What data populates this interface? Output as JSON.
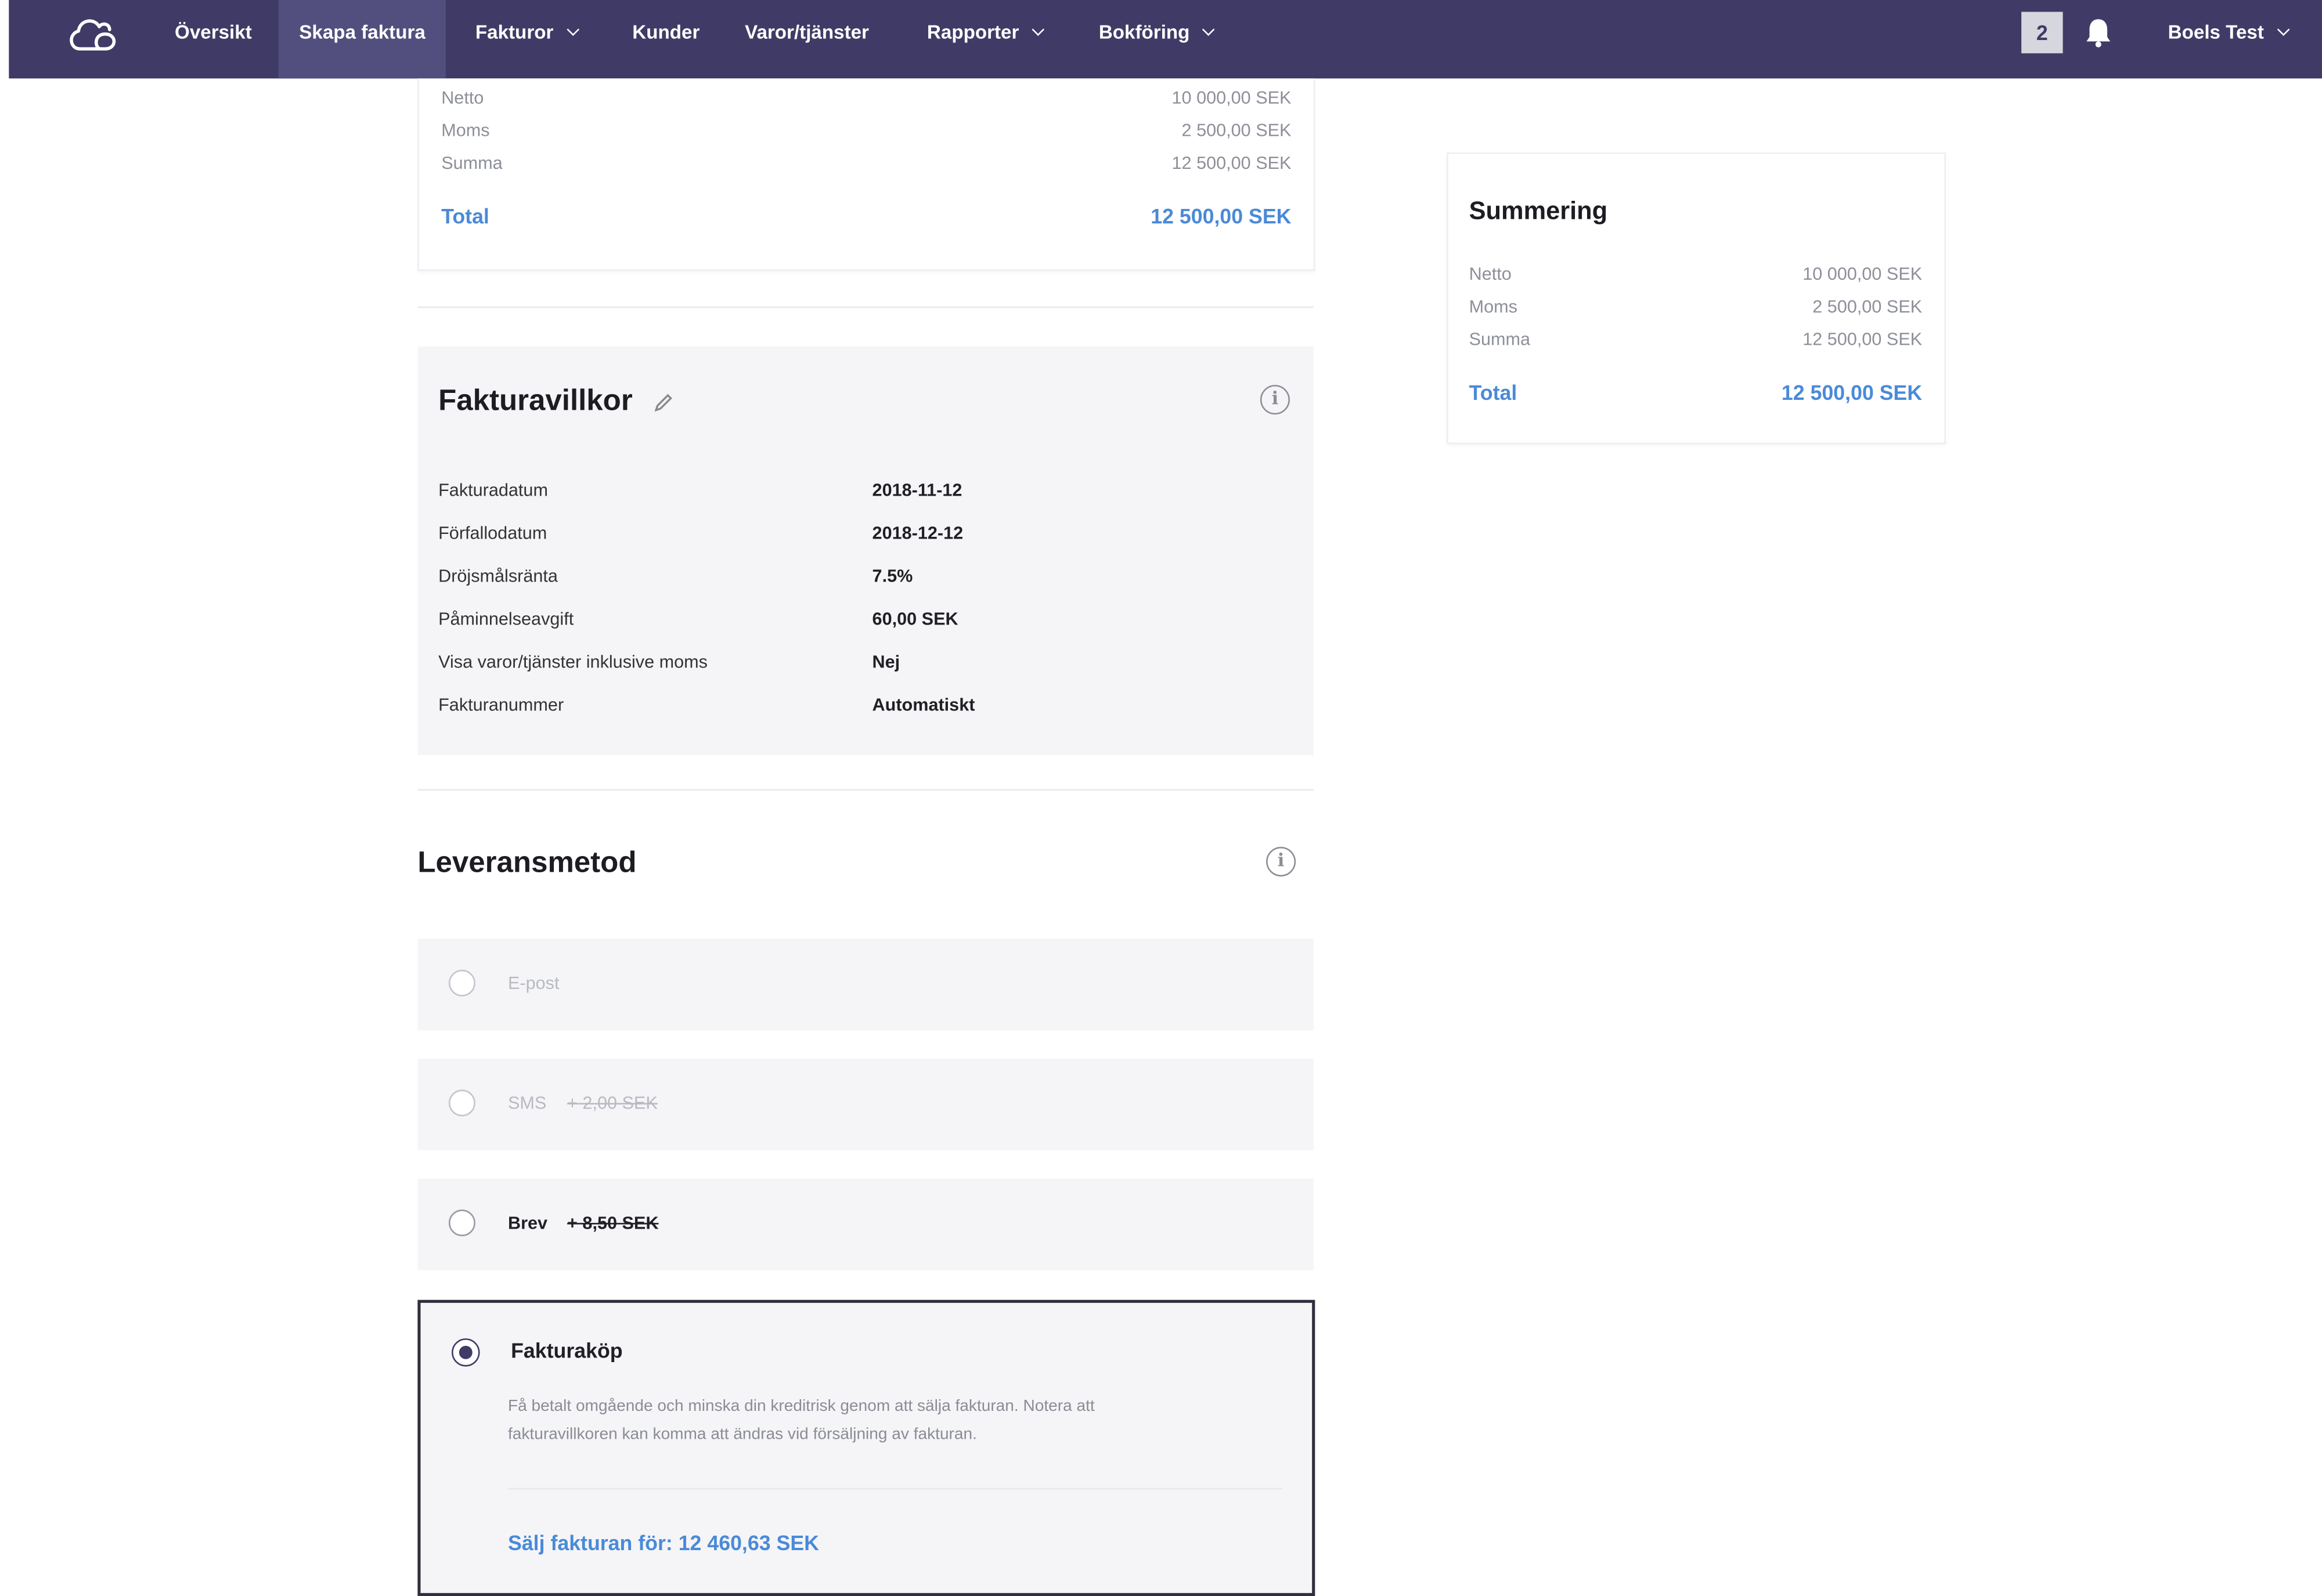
{
  "nav": {
    "items": [
      "Översikt",
      "Skapa faktura",
      "Fakturor",
      "Kunder",
      "Varor/tjänster",
      "Rapporter",
      "Bokföring"
    ],
    "notification_count": "2",
    "user": "Boels Test"
  },
  "top_summary": {
    "netto_label": "Netto",
    "netto_value": "10 000,00 SEK",
    "moms_label": "Moms",
    "moms_value": "2 500,00 SEK",
    "summa_label": "Summa",
    "summa_value": "12 500,00 SEK",
    "total_label": "Total",
    "total_value": "12 500,00 SEK"
  },
  "summary_card": {
    "title": "Summering",
    "netto_label": "Netto",
    "netto_value": "10 000,00 SEK",
    "moms_label": "Moms",
    "moms_value": "2 500,00 SEK",
    "summa_label": "Summa",
    "summa_value": "12 500,00 SEK",
    "total_label": "Total",
    "total_value": "12 500,00 SEK"
  },
  "terms": {
    "title": "Fakturavillkor",
    "rows": [
      {
        "label": "Fakturadatum",
        "value": "2018-11-12"
      },
      {
        "label": "Förfallodatum",
        "value": "2018-12-12"
      },
      {
        "label": "Dröjsmålsränta",
        "value": "7.5%"
      },
      {
        "label": "Påminnelseavgift",
        "value": "60,00 SEK"
      },
      {
        "label": "Visa varor/tjänster inklusive moms",
        "value": "Nej"
      },
      {
        "label": "Fakturanummer",
        "value": "Automatiskt"
      }
    ]
  },
  "delivery": {
    "title": "Leveransmetod",
    "options": [
      {
        "label": "E-post",
        "price": ""
      },
      {
        "label": "SMS",
        "price": "+ 2,00 SEK"
      },
      {
        "label": "Brev",
        "price": "+ 8,50 SEK"
      }
    ],
    "selected": {
      "label": "Fakturaköp",
      "description_1": "Få betalt omgående och minska din kreditrisk genom att sälja fakturan. Notera att",
      "description_2": "fakturavillkoren kan komma att ändras vid försäljning av fakturan.",
      "sell_link": "Sälj fakturan för: 12 460,63 SEK"
    }
  }
}
